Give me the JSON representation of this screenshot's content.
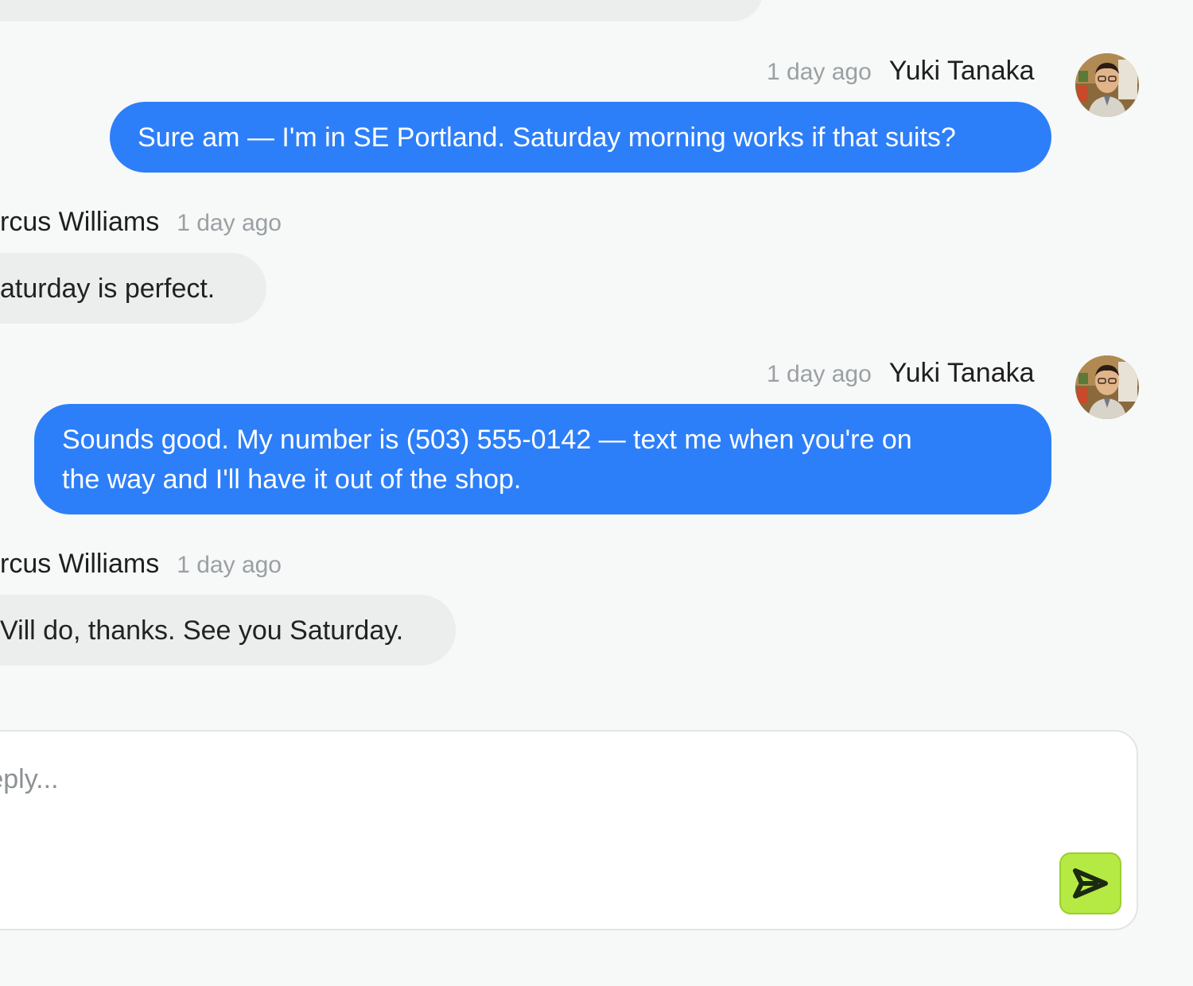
{
  "messages": [
    {
      "id": "m1",
      "sender": "Yuki Tanaka",
      "time": "1 day ago",
      "text": "Sure am — I'm in SE Portland. Saturday morning works if that suits?"
    },
    {
      "id": "m2",
      "sender": "rcus Williams",
      "time": "1 day ago",
      "text": "aturday is perfect."
    },
    {
      "id": "m3",
      "sender": "Yuki Tanaka",
      "time": "1 day ago",
      "text_line1": "Sounds good. My number is (503) 555-0142 — text me when you're on",
      "text_line2": "the way and I'll have it out of the shop."
    },
    {
      "id": "m4",
      "sender": "rcus Williams",
      "time": "1 day ago",
      "text": "Vill do, thanks. See you Saturday."
    }
  ],
  "composer": {
    "placeholder": "reply..."
  },
  "colors": {
    "outgoing_bubble": "#2d7ff9",
    "incoming_bubble": "#eceeee",
    "send_button": "#b5ea45",
    "background": "#f7f8f8"
  },
  "icons": {
    "send": "send-arrow-icon",
    "avatar": "user-avatar"
  }
}
